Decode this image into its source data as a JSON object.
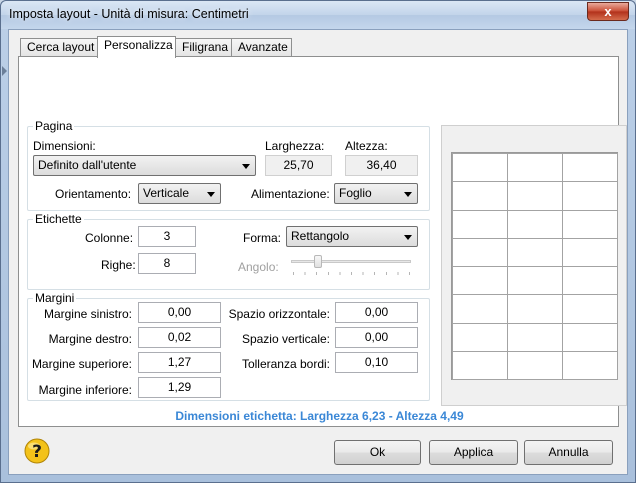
{
  "window": {
    "title": "Imposta layout - Unità di misura: Centimetri",
    "close_glyph": "x"
  },
  "tabs": [
    {
      "label": "Cerca layout",
      "active": false
    },
    {
      "label": "Personalizza",
      "active": true
    },
    {
      "label": "Filigrana",
      "active": false
    },
    {
      "label": "Avanzate",
      "active": false
    }
  ],
  "pagina": {
    "legend": "Pagina",
    "dimensioni_label": "Dimensioni:",
    "dimensioni_value": "Definito dall'utente",
    "larghezza_label": "Larghezza:",
    "larghezza_value": "25,70",
    "altezza_label": "Altezza:",
    "altezza_value": "36,40",
    "orientamento_label": "Orientamento:",
    "orientamento_value": "Verticale",
    "alimentazione_label": "Alimentazione:",
    "alimentazione_value": "Foglio"
  },
  "etichette": {
    "legend": "Etichette",
    "colonne_label": "Colonne:",
    "colonne_value": "3",
    "righe_label": "Righe:",
    "righe_value": "8",
    "forma_label": "Forma:",
    "forma_value": "Rettangolo",
    "angolo_label": "Angolo:"
  },
  "margini": {
    "legend": "Margini",
    "sinistro_label": "Margine sinistro:",
    "sinistro_value": "0,00",
    "destro_label": "Margine destro:",
    "destro_value": "0,02",
    "superiore_label": "Margine superiore:",
    "superiore_value": "1,27",
    "inferiore_label": "Margine inferiore:",
    "inferiore_value": "1,29",
    "spazio_orizz_label": "Spazio orizzontale:",
    "spazio_orizz_value": "0,00",
    "spazio_vert_label": "Spazio verticale:",
    "spazio_vert_value": "0,00",
    "tolleranza_label": "Tolleranza bordi:",
    "tolleranza_value": "0,10"
  },
  "summary": "Dimensioni etichetta: Larghezza 6,23 - Altezza 4,49",
  "buttons": {
    "ok": "Ok",
    "applica": "Applica",
    "annulla": "Annulla",
    "help_glyph": "?"
  },
  "colors": {
    "summary_text": "#3a87d6",
    "help_icon": "#f3c21a"
  }
}
